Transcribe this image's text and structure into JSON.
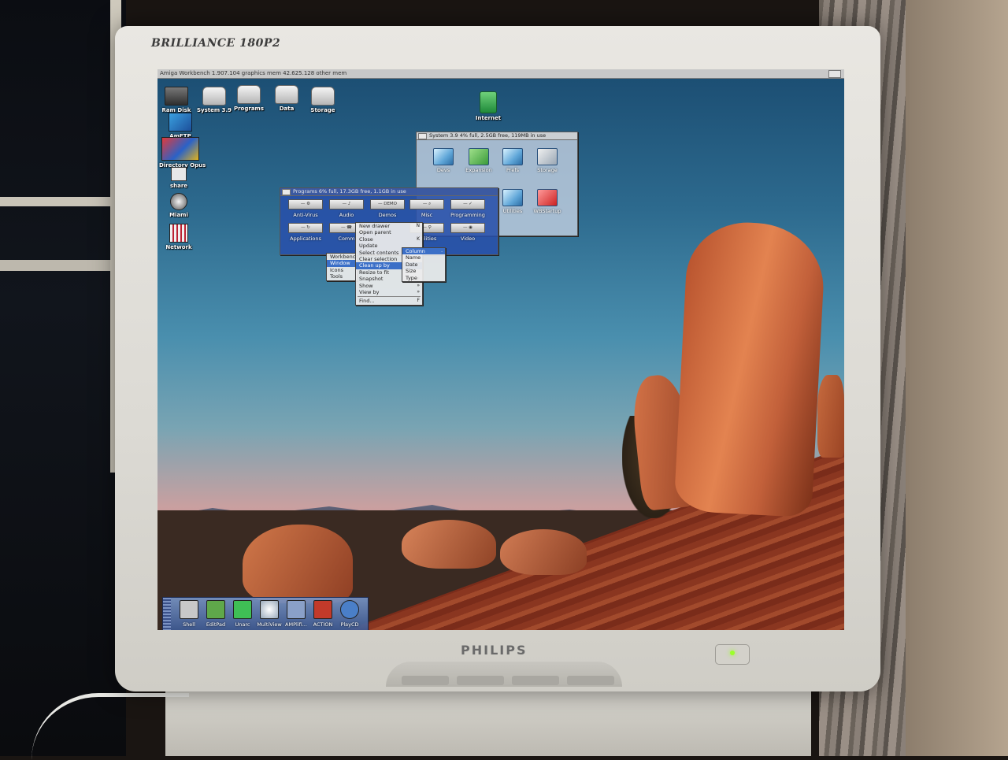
{
  "monitor": {
    "brand_model": "BRILLIANCE 180P2",
    "manufacturer": "PHILIPS"
  },
  "workbench": {
    "title": "Amiga Workbench  1.907.104 graphics mem  42.625.128 other mem"
  },
  "desktop_icons": [
    {
      "label": "Ram Disk",
      "icon": "ram-disk-icon"
    },
    {
      "label": "System 3.9",
      "icon": "hard-drive-icon"
    },
    {
      "label": "Programs",
      "icon": "hard-drive-icon"
    },
    {
      "label": "Data",
      "icon": "hard-drive-icon"
    },
    {
      "label": "Storage",
      "icon": "hard-drive-icon"
    },
    {
      "label": "Internet",
      "icon": "drawer-icon"
    },
    {
      "label": "AmFTP",
      "icon": "ftp-icon"
    },
    {
      "label": "Directory Opus",
      "icon": "opus-icon"
    },
    {
      "label": "share",
      "icon": "share-icon"
    },
    {
      "label": "Miami",
      "icon": "miami-icon"
    },
    {
      "label": "Network",
      "icon": "network-icon"
    }
  ],
  "system_window": {
    "title": "System 3.9  4% full, 2.5GB free, 119MB in use",
    "drawers": [
      "Devs",
      "Expansion",
      "Prefs",
      "Storage",
      "Utilities",
      "WBStartup"
    ]
  },
  "programs_window": {
    "title": "Programs  6% full, 17.3GB free, 1.1GB in use",
    "drawers": [
      "Anti-Virus",
      "Audio",
      "Demos",
      "Misc",
      "Programming",
      "Applications",
      "Comm",
      "Utilities",
      "Video"
    ],
    "demo_badge": "DEMO"
  },
  "menu_bar": {
    "items": [
      "Workbench",
      "Window",
      "Icons",
      "Tools"
    ]
  },
  "window_menu": {
    "items": [
      {
        "label": "New drawer",
        "shortcut": "N"
      },
      {
        "label": "Open parent",
        "shortcut": ""
      },
      {
        "label": "Close",
        "shortcut": "K"
      },
      {
        "label": "Update",
        "shortcut": ""
      },
      {
        "label": "Select contents",
        "shortcut": "A"
      },
      {
        "label": "Clear selection",
        "shortcut": ""
      },
      {
        "label": "Clean up by",
        "shortcut": "»"
      },
      {
        "label": "Resize to fit",
        "shortcut": ""
      },
      {
        "label": "Snapshot",
        "shortcut": "»"
      },
      {
        "label": "Show",
        "shortcut": "»"
      },
      {
        "label": "View by",
        "shortcut": "»"
      },
      {
        "label": "Find...",
        "shortcut": "F"
      }
    ]
  },
  "cleanup_submenu": {
    "items": [
      {
        "label": "Column",
        "shortcut": "."
      },
      {
        "label": "Name",
        "shortcut": ""
      },
      {
        "label": "Date",
        "shortcut": ""
      },
      {
        "label": "Size",
        "shortcut": ""
      },
      {
        "label": "Type",
        "shortcut": ""
      }
    ]
  },
  "dock": {
    "items": [
      {
        "label": "Shell",
        "color": "#c8c8c8"
      },
      {
        "label": "EditPad",
        "color": "#5fa84a"
      },
      {
        "label": "Unarc",
        "color": "#3fbf55"
      },
      {
        "label": "MultiView",
        "color": "#dcdcdc"
      },
      {
        "label": "AMPlifi...",
        "color": "#8aa0c8"
      },
      {
        "label": "ACTION",
        "color": "#c23a2a"
      },
      {
        "label": "PlayCD",
        "color": "#4a7fc8"
      }
    ]
  },
  "colors": {
    "highlight": "#3b6fc7",
    "power_led": "#9cff2a"
  }
}
